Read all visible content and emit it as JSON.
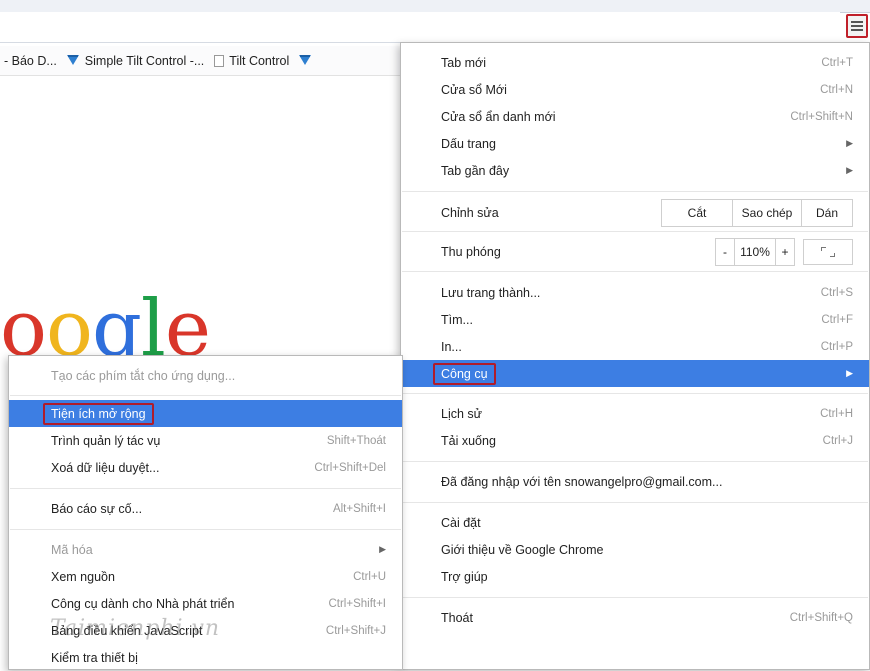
{
  "bookmarks": [
    {
      "label": "- Báo D...",
      "icon": "none"
    },
    {
      "label": "Simple Tilt Control -...",
      "icon": "vlc-icon"
    },
    {
      "label": "Tilt Control",
      "icon": "page-icon"
    }
  ],
  "logo_text": {
    "o1": "o",
    "o2": "o",
    "g": "g",
    "l": "l",
    "e": "e"
  },
  "main_menu": {
    "new_tab": {
      "label": "Tab mới",
      "shortcut": "Ctrl+T"
    },
    "new_window": {
      "label": "Cửa sổ Mới",
      "shortcut": "Ctrl+N"
    },
    "incognito": {
      "label": "Cửa sổ ẩn danh mới",
      "shortcut": "Ctrl+Shift+N"
    },
    "bookmarks": {
      "label": "Dấu trang"
    },
    "recent_tabs": {
      "label": "Tab gần đây"
    },
    "edit": {
      "label": "Chỉnh sửa",
      "cut": "Cắt",
      "copy": "Sao chép",
      "paste": "Dán"
    },
    "zoom": {
      "label": "Thu phóng",
      "minus": "-",
      "value": "110%",
      "plus": "+"
    },
    "save_page": {
      "label": "Lưu trang thành...",
      "shortcut": "Ctrl+S"
    },
    "find": {
      "label": "Tìm...",
      "shortcut": "Ctrl+F"
    },
    "print": {
      "label": "In...",
      "shortcut": "Ctrl+P"
    },
    "tools": {
      "label": "Công cụ"
    },
    "history": {
      "label": "Lịch sử",
      "shortcut": "Ctrl+H"
    },
    "downloads": {
      "label": "Tải xuống",
      "shortcut": "Ctrl+J"
    },
    "signed_in": {
      "label": "Đã đăng nhập với tên snowangelpro@gmail.com..."
    },
    "settings": {
      "label": "Cài đặt"
    },
    "about": {
      "label": "Giới thiệu về Google Chrome"
    },
    "help": {
      "label": "Trợ giúp"
    },
    "exit": {
      "label": "Thoát",
      "shortcut": "Ctrl+Shift+Q"
    }
  },
  "tools_menu": {
    "create_shortcuts": {
      "label": "Tạo các phím tắt cho ứng dụng..."
    },
    "extensions": {
      "label": "Tiện ích mở rộng"
    },
    "task_manager": {
      "label": "Trình quản lý tác vụ",
      "shortcut": "Shift+Thoát"
    },
    "clear_data": {
      "label": "Xoá dữ liệu duyệt...",
      "shortcut": "Ctrl+Shift+Del"
    },
    "report_issue": {
      "label": "Báo cáo sự cố...",
      "shortcut": "Alt+Shift+I"
    },
    "encoding": {
      "label": "Mã hóa"
    },
    "view_source": {
      "label": "Xem nguồn",
      "shortcut": "Ctrl+U"
    },
    "dev_tools": {
      "label": "Công cụ dành cho Nhà phát triển",
      "shortcut": "Ctrl+Shift+I"
    },
    "js_console": {
      "label": "Bảng điều khiển JavaScript",
      "shortcut": "Ctrl+Shift+J"
    },
    "inspect_devices": {
      "label": "Kiểm tra thiết bị"
    }
  },
  "watermark": "Taimienphi.vn",
  "colors": {
    "selection": "#3d7ee3",
    "highlight_box": "#b01c2a"
  }
}
